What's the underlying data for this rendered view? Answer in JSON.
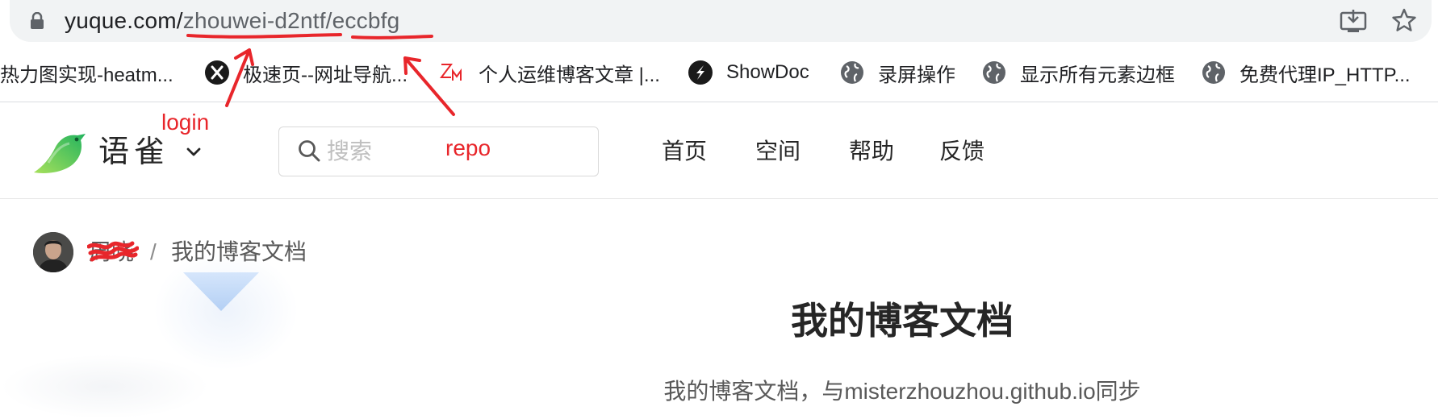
{
  "browser": {
    "url_host": "yuque.com/",
    "url_path": "zhouwei-d2ntf/eccbfg"
  },
  "bookmarks": [
    {
      "label": "热力图实现-heatm...",
      "icon": "none"
    },
    {
      "label": "极速页--网址导航...",
      "icon": "x-logo-icon"
    },
    {
      "label": "个人运维博客文章 |...",
      "icon": "zm-logo-icon"
    },
    {
      "label": "ShowDoc",
      "icon": "showdoc-logo-icon"
    },
    {
      "label": "录屏操作",
      "icon": "globe-icon"
    },
    {
      "label": "显示所有元素边框",
      "icon": "globe-icon"
    },
    {
      "label": "免费代理IP_HTTP...",
      "icon": "globe-icon"
    }
  ],
  "header": {
    "logo_text": "语雀",
    "search_placeholder": "搜索",
    "nav": [
      "首页",
      "空间",
      "帮助",
      "反馈"
    ]
  },
  "annotations": {
    "login": "login",
    "repo": "repo",
    "color": "#e8262b"
  },
  "breadcrumb": {
    "user": "周晓",
    "separator": "/",
    "book": "我的博客文档"
  },
  "book": {
    "title": "我的博客文档",
    "description": "我的博客文档，与misterzhouzhou.github.io同步"
  },
  "colors": {
    "accent_green": "#25b864",
    "annotation_red": "#e8262b",
    "address_bar_bg": "#f1f3f4"
  }
}
